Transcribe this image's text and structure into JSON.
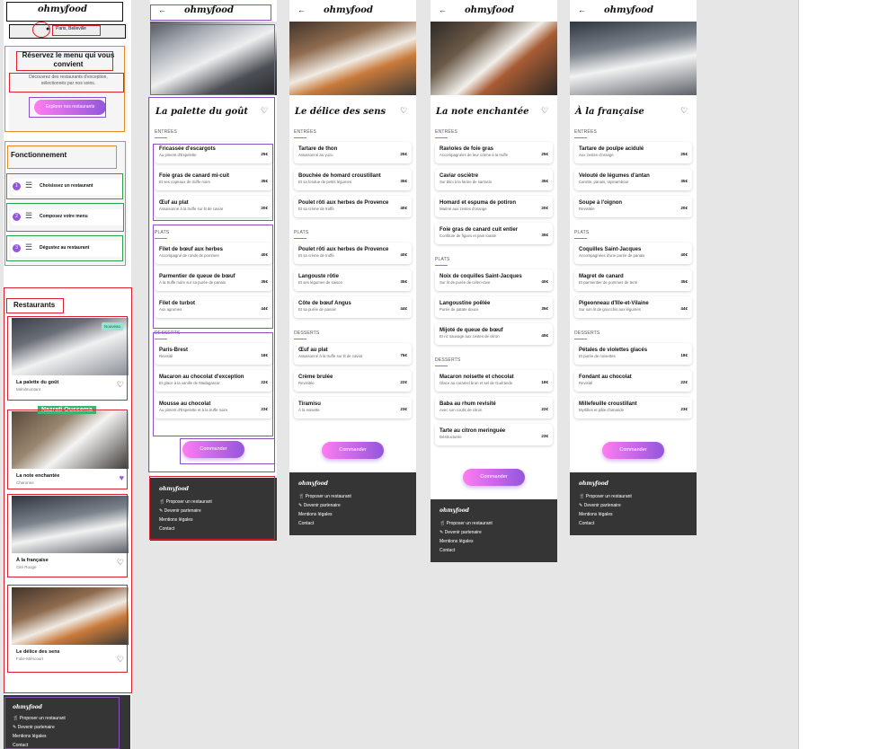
{
  "brand": "ohmyfood",
  "home": {
    "location": "Paris, Belleville",
    "hero_title": "Réservez le menu qui vous convient",
    "hero_text": "Découvrez des restaurants d'exception, sélectionnés par nos soins.",
    "explore_btn": "Explorer nos restaurants",
    "how_title": "Fonctionnement",
    "steps": [
      {
        "num": "1",
        "label": "Choisissez un restaurant"
      },
      {
        "num": "2",
        "label": "Composez votre menu"
      },
      {
        "num": "3",
        "label": "Dégustez au restaurant"
      }
    ],
    "restaurants_title": "Restaurants",
    "restaurants": [
      {
        "name": "La palette du goût",
        "area": "Ménilmontant",
        "badge": "Nouveau"
      },
      {
        "name": "La note enchantée",
        "area": "Charonne"
      },
      {
        "name": "À la française",
        "area": "Cité Rouge"
      },
      {
        "name": "Le délice des sens",
        "area": "Folie-Méricourt"
      }
    ],
    "annotation_tag": "Nazrati Oussema"
  },
  "footer": {
    "brand": "ohmyfood",
    "links": [
      "Proposer un restaurant",
      "Devenir partenaire",
      "Mentions légales",
      "Contact"
    ]
  },
  "order_btn": "Commander",
  "menus": [
    {
      "title": "La palette du goût",
      "sections": [
        {
          "name": "ENTRÉES",
          "items": [
            {
              "n": "Fricassée d'escargots",
              "d": "Au piment d'Espelette",
              "p": "25€"
            },
            {
              "n": "Foie gras de canard mi-cuit",
              "d": "Et ses copeaux de truffe noire",
              "p": "35€"
            },
            {
              "n": "Œuf au plat",
              "d": "Assaisonné à la truffe sur lit de caviar",
              "p": "20€"
            }
          ]
        },
        {
          "name": "PLATS",
          "items": [
            {
              "n": "Filet de bœuf aux herbes",
              "d": "Accompagné de ronds de pommes",
              "p": "40€"
            },
            {
              "n": "Parmentier de queue de bœuf",
              "d": "À la truffe noire sur sa purée de panais",
              "p": "35€"
            },
            {
              "n": "Filet de turbot",
              "d": "Aux agrumes",
              "p": "44€"
            }
          ]
        },
        {
          "name": "DESSERTS",
          "items": [
            {
              "n": "Paris-Brest",
              "d": "Revisité",
              "p": "18€"
            },
            {
              "n": "Macaron au chocolat d'exception",
              "d": "Et glace à la vanille de Madagascar",
              "p": "22€"
            },
            {
              "n": "Mousse au chocolat",
              "d": "Au piment d'Espelette et à la truffe noire",
              "p": "23€"
            }
          ]
        }
      ]
    },
    {
      "title": "Le délice des sens",
      "sections": [
        {
          "name": "ENTRÉES",
          "items": [
            {
              "n": "Tartare de thon",
              "d": "Assaisonné au yuzu",
              "p": "25€"
            },
            {
              "n": "Bouchée de homard croustillant",
              "d": "Et sa fondue de petits légumes",
              "p": "35€"
            },
            {
              "n": "Poulet rôti aux herbes de Provence",
              "d": "Et sa crème de truffe",
              "p": "40€"
            }
          ]
        },
        {
          "name": "PLATS",
          "items": [
            {
              "n": "Poulet rôti aux herbes de Provence",
              "d": "Et sa crème de truffe",
              "p": "40€"
            },
            {
              "n": "Langouste rôtie",
              "d": "Et ses légumes de saison",
              "p": "35€"
            },
            {
              "n": "Côte de bœuf Angus",
              "d": "Et sa purée de panais",
              "p": "44€"
            }
          ]
        },
        {
          "name": "DESSERTS",
          "items": [
            {
              "n": "Œuf au plat",
              "d": "Assaisonné à la truffe sur lit de caviar",
              "p": "76€"
            },
            {
              "n": "Crème brulée",
              "d": "Revisitée",
              "p": "22€"
            },
            {
              "n": "Tiramisu",
              "d": "À la noisette",
              "p": "23€"
            }
          ]
        }
      ]
    },
    {
      "title": "La note enchantée",
      "sections": [
        {
          "name": "ENTRÉES",
          "items": [
            {
              "n": "Ravioles de foie gras",
              "d": "Accompagnées de leur crème à la truffe",
              "p": "25€"
            },
            {
              "n": "Caviar osciètre",
              "d": "Sur blini à la farine de sarrasin",
              "p": "35€"
            },
            {
              "n": "Homard et espuma de potiron",
              "d": "Mariné aux zestes d'orange",
              "p": "20€"
            },
            {
              "n": "Foie gras de canard cuit entier",
              "d": "Confiture de figues et pain toasté",
              "p": "35€"
            }
          ]
        },
        {
          "name": "PLATS",
          "items": [
            {
              "n": "Noix de coquilles Saint-Jacques",
              "d": "Sur lit de purée de céleri-rave",
              "p": "40€"
            },
            {
              "n": "Langoustine poêlée",
              "d": "Purée de patate douce",
              "p": "35€"
            },
            {
              "n": "Mijoté de queue de bœuf",
              "d": "Et riz sauvage aux zestes de citron",
              "p": "45€"
            }
          ]
        },
        {
          "name": "DESSERTS",
          "items": [
            {
              "n": "Macaron noisette et chocolat",
              "d": "Glace au caramel brun et sel de Guérande",
              "p": "18€"
            },
            {
              "n": "Baba au rhum revisité",
              "d": "Avec son coulis de citron",
              "p": "22€"
            },
            {
              "n": "Tarte au citron meringuée",
              "d": "Déstructurée",
              "p": "23€"
            }
          ]
        }
      ]
    },
    {
      "title": "À la française",
      "sections": [
        {
          "name": "ENTRÉES",
          "items": [
            {
              "n": "Tartare de poulpe acidulé",
              "d": "Aux zestes d'orange",
              "p": "25€"
            },
            {
              "n": "Velouté de légumes d'antan",
              "d": "Carotte, panais, topinambour",
              "p": "35€"
            },
            {
              "n": "Soupe à l'oignon",
              "d": "Revisitée",
              "p": "20€"
            }
          ]
        },
        {
          "name": "PLATS",
          "items": [
            {
              "n": "Coquilles Saint-Jacques",
              "d": "Accompagnées d'une purée de panais",
              "p": "40€"
            },
            {
              "n": "Magret de canard",
              "d": "Et parmentier de pommes de terre",
              "p": "35€"
            },
            {
              "n": "Pigeonneau d'Ille-et-Vilaine",
              "d": "Sur son lit de gnocchis aux légumes",
              "p": "44€"
            }
          ]
        },
        {
          "name": "DESSERTS",
          "items": [
            {
              "n": "Pétales de violettes glacés",
              "d": "Et purée de noisettes",
              "p": "18€"
            },
            {
              "n": "Fondant au chocolat",
              "d": "Revisité",
              "p": "22€"
            },
            {
              "n": "Millefeuille croustillant",
              "d": "Myrtilles et pâte d'amande",
              "p": "23€"
            }
          ]
        }
      ]
    }
  ],
  "colors": {
    "accent": "#9356dc",
    "accent_light": "#ff7cf1",
    "footer_bg": "#353535",
    "badge": "#99e2d0",
    "annotation_tag": "#3cb371"
  }
}
